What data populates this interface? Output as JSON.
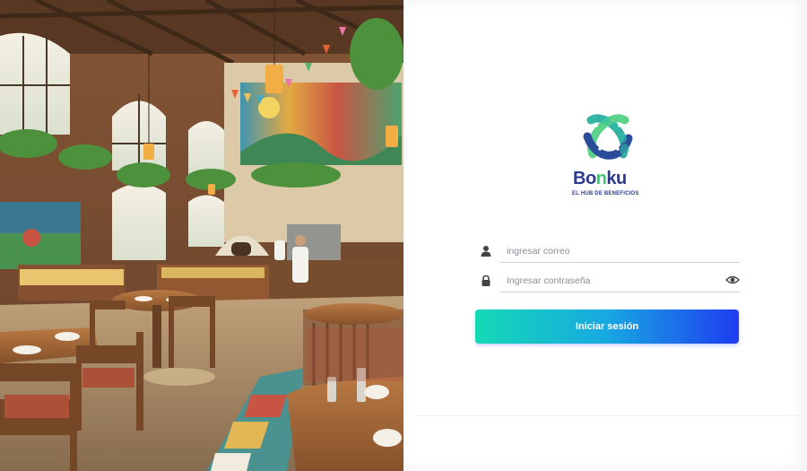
{
  "brand": {
    "name_part1": "Bo",
    "name_part2": "n",
    "name_part3": "ku",
    "tagline": "EL HUB DE BENEFICIOS",
    "colors": {
      "navy": "#2b3a8c",
      "green": "#49c27a",
      "teal": "#2aa8a0"
    }
  },
  "login": {
    "email_placeholder": "ingresar correo",
    "password_placeholder": "Ingresar contraseña",
    "submit_label": "Iniciar sesión",
    "email_icon": "user-icon",
    "password_icon": "lock-icon",
    "toggle_icon": "eye-icon"
  },
  "hero": {
    "description_icon": "restaurant-photo"
  },
  "colors": {
    "button_start": "#14d9b5",
    "button_mid": "#18a8e2",
    "button_end": "#1f3cf0"
  }
}
